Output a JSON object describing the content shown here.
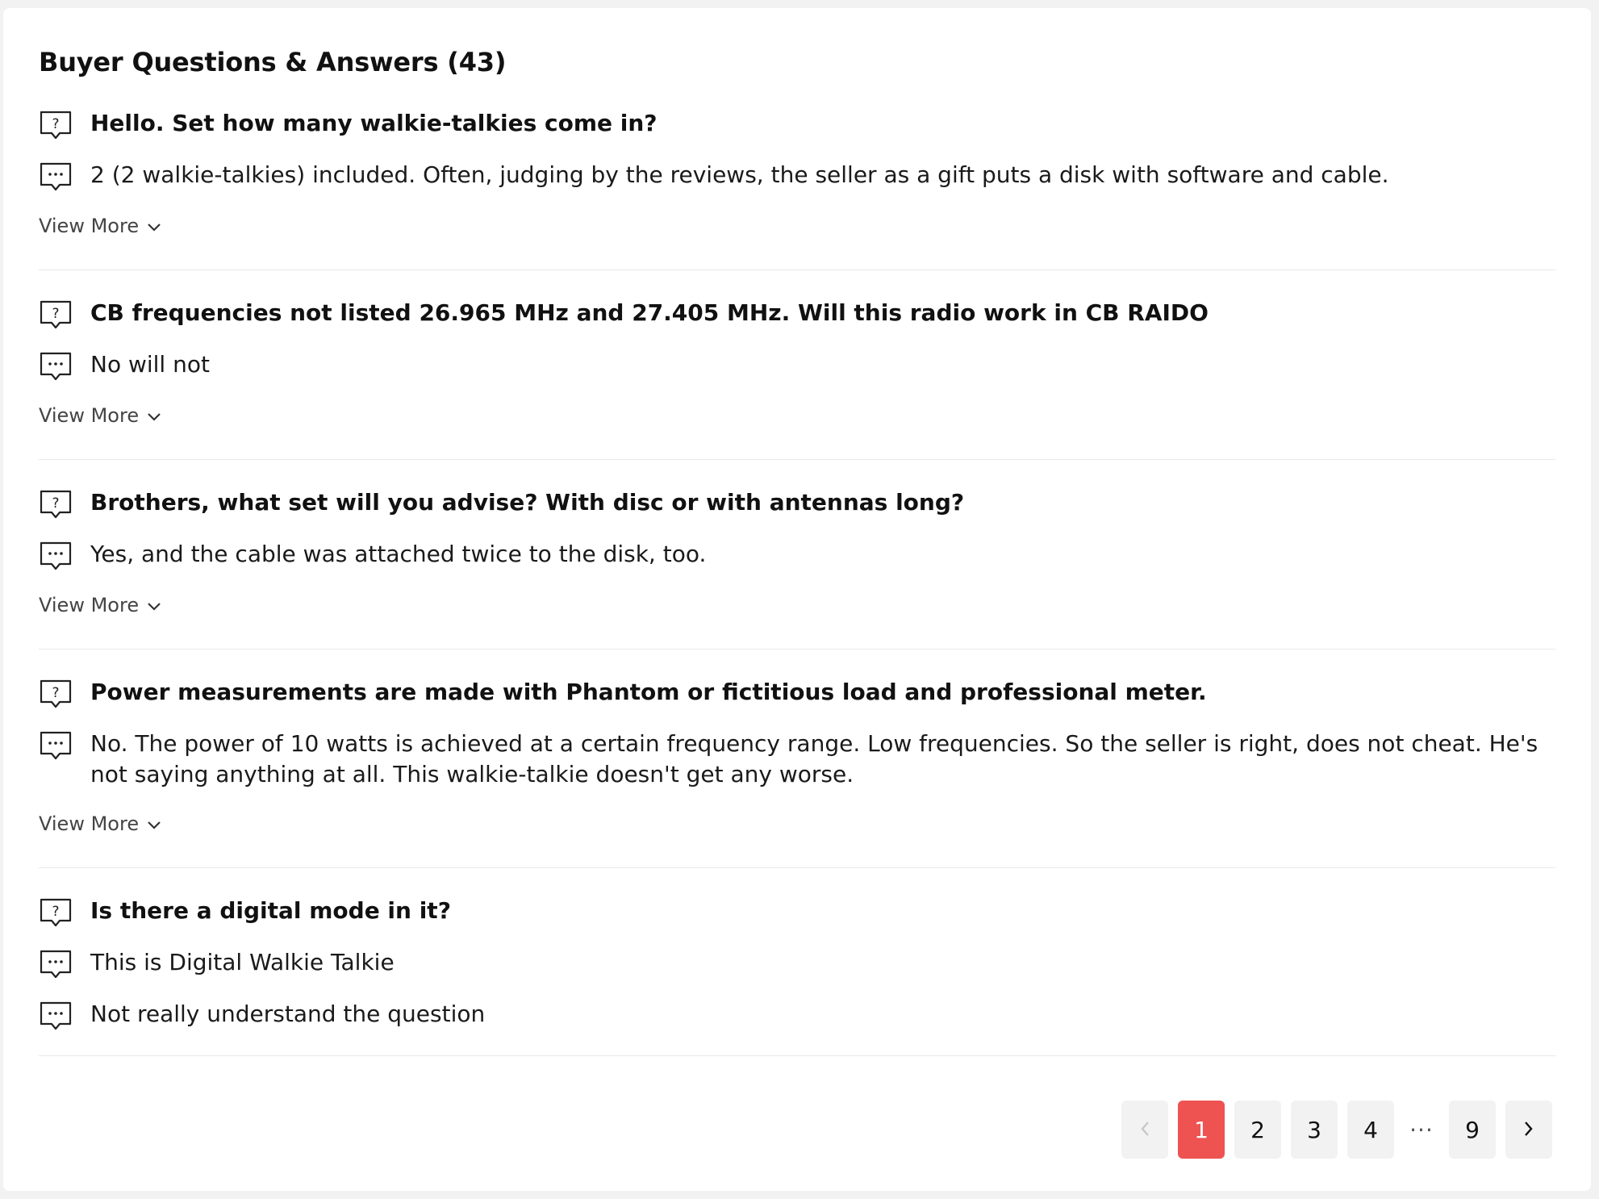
{
  "section": {
    "title": "Buyer Questions & Answers (43)"
  },
  "view_more_label": "View More",
  "qa": [
    {
      "question": "Hello. Set how many walkie-talkies come in?",
      "answers": [
        "2 (2 walkie-talkies) included. Often, judging by the reviews, the seller as a gift puts a disk with software and cable."
      ],
      "has_view_more": true
    },
    {
      "question": "CB frequencies not listed 26.965 MHz and 27.405 MHz. Will this radio work in CB RAIDO",
      "answers": [
        "No will not"
      ],
      "has_view_more": true
    },
    {
      "question": "Brothers, what set will you advise? With disc or with antennas long?",
      "answers": [
        "Yes, and the cable was attached twice to the disk, too."
      ],
      "has_view_more": true
    },
    {
      "question": "Power measurements are made with Phantom or fictitious load and professional meter.",
      "answers": [
        "No. The power of 10 watts is achieved at a certain frequency range. Low frequencies. So the seller is right, does not cheat. He's not saying anything at all. This walkie-talkie doesn't get any worse."
      ],
      "has_view_more": true
    },
    {
      "question": "Is there a digital mode in it?",
      "answers": [
        "This is Digital Walkie Talkie",
        "Not really understand the question"
      ],
      "has_view_more": false
    }
  ],
  "pagination": {
    "prev_icon": "chevron-left-icon",
    "next_icon": "chevron-right-icon",
    "pages": [
      "1",
      "2",
      "3",
      "4"
    ],
    "ellipsis": "···",
    "last_page": "9",
    "current": "1",
    "active_color": "#ee5352"
  }
}
